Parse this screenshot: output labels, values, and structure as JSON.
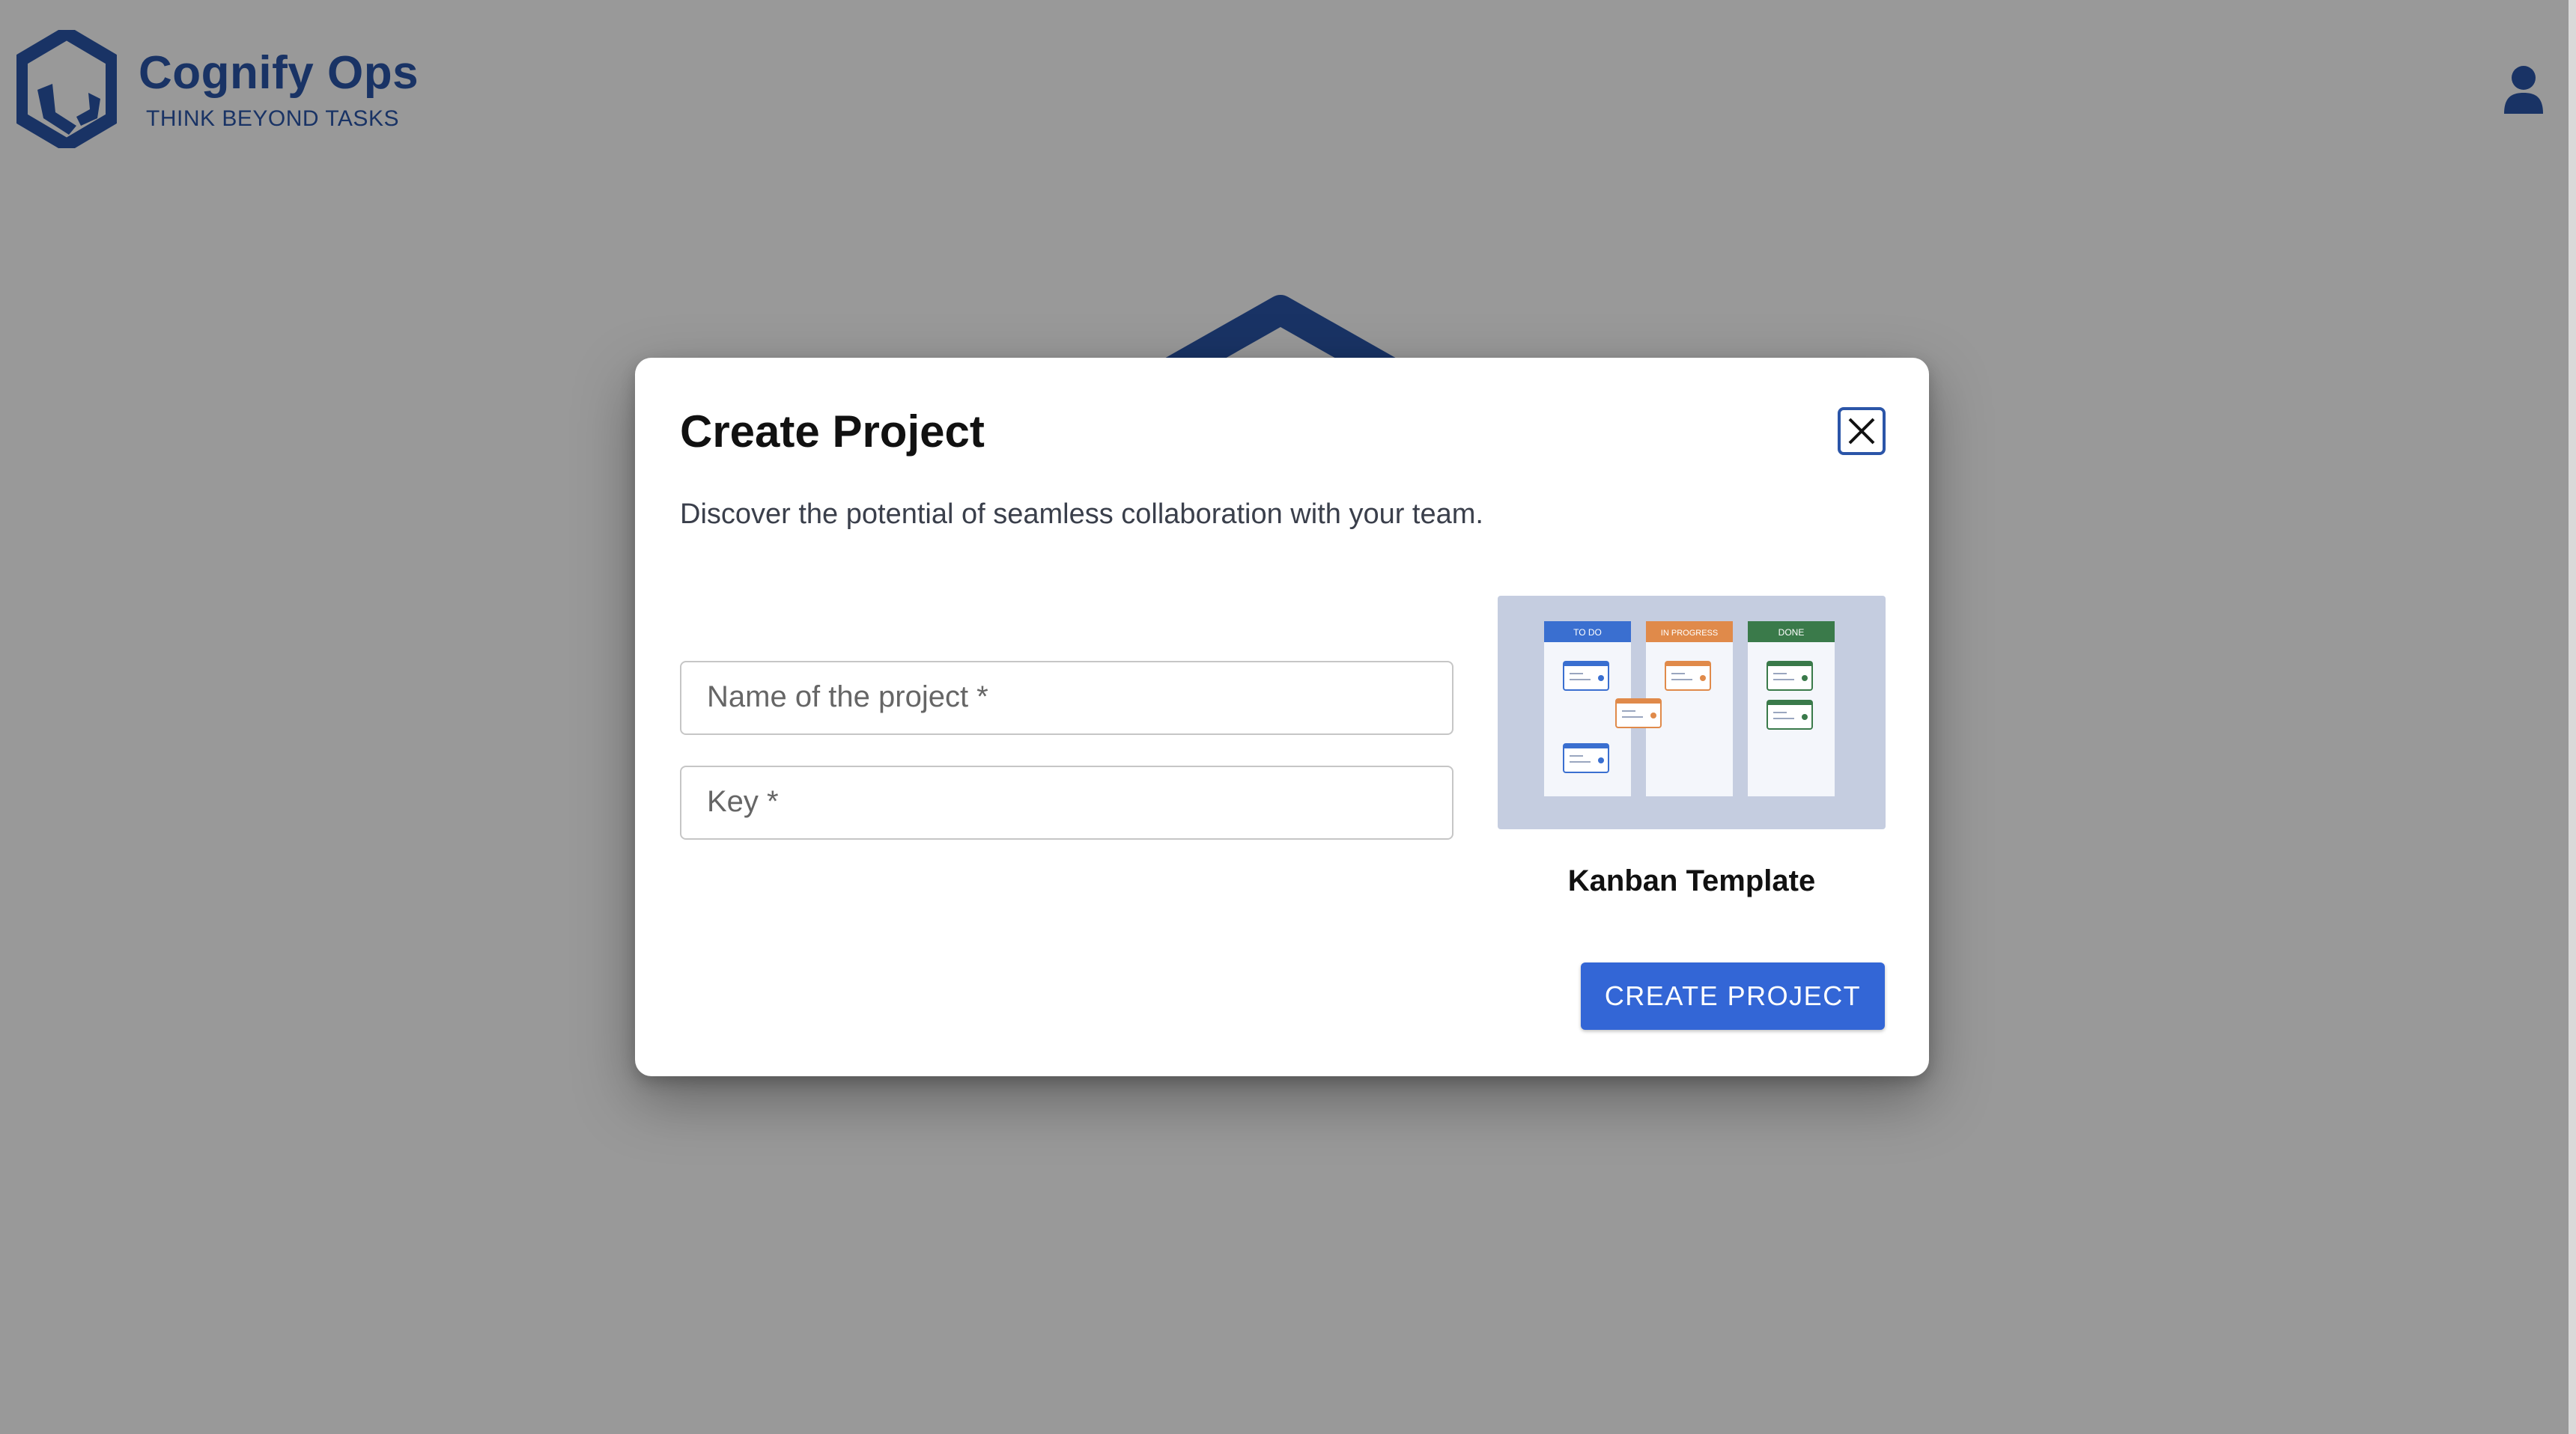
{
  "header": {
    "brand_name": "Cognify Ops",
    "tagline": "THINK BEYOND TASKS"
  },
  "modal": {
    "title": "Create Project",
    "subtitle": "Discover the potential of seamless collaboration with your team.",
    "fields": {
      "name": {
        "label": "Name of the project *",
        "value": ""
      },
      "key": {
        "label": "Key *",
        "value": ""
      }
    },
    "template": {
      "name": "Kanban Template",
      "columns": [
        {
          "label": "TO DO",
          "color": "#3a6fd0"
        },
        {
          "label": "IN PROGRESS",
          "color": "#e08a4a"
        },
        {
          "label": "DONE",
          "color": "#3a7a4a"
        }
      ]
    },
    "create_label": "CREATE PROJECT"
  },
  "colors": {
    "brand": "#2b55a8",
    "primary_button": "#3366d6",
    "backdrop": "rgba(0,0,0,0.40)"
  },
  "icons": {
    "brand": "cognify-logo-icon",
    "user": "user-icon",
    "close": "close-icon"
  }
}
